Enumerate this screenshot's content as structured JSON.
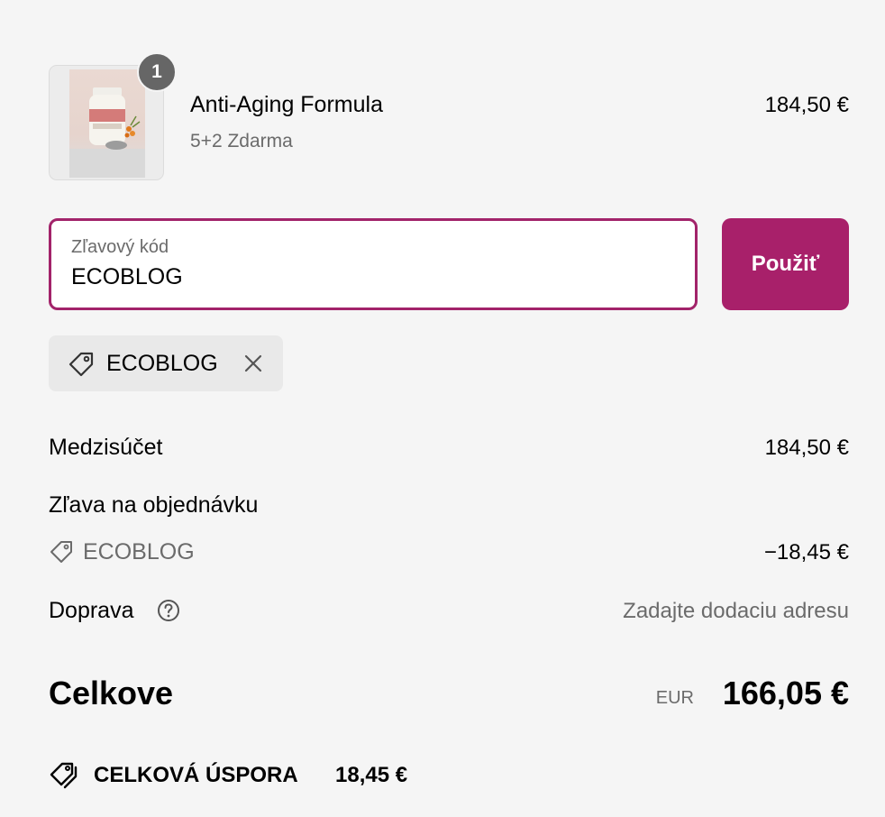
{
  "line_item": {
    "quantity_badge": "1",
    "title": "Anti-Aging Formula",
    "variant": "5+2 Zdarma",
    "price": "184,50 €"
  },
  "discount": {
    "label": "Zľavový kód",
    "value": "ECOBLOG",
    "apply_label": "Použiť",
    "applied_chip": "ECOBLOG",
    "accent_color": "#a8206a"
  },
  "summary": {
    "subtotal_label": "Medzisúčet",
    "subtotal_value": "184,50 €",
    "order_discount_label": "Zľava na objednávku",
    "order_discount_code": "ECOBLOG",
    "order_discount_value": "−18,45 €",
    "shipping_label": "Doprava",
    "shipping_value": "Zadajte dodaciu adresu",
    "total_label": "Celkove",
    "total_currency": "EUR",
    "total_value": "166,05 €",
    "savings_label": "CELKOVÁ ÚSPORA",
    "savings_value": "18,45 €"
  },
  "icons": {
    "chip": "tag-icon",
    "chip_remove": "close-icon",
    "discount_row": "tag-icon",
    "shipping_help": "help-circle-icon",
    "savings": "tags-icon"
  }
}
